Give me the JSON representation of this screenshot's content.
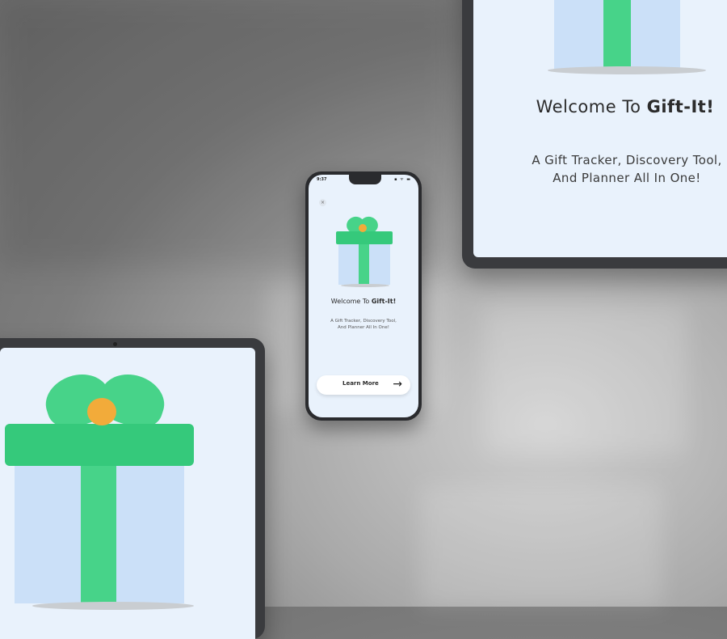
{
  "phone": {
    "status_time": "9:37",
    "status_icons": "▪︎ ᯤ ▬",
    "close_glyph": "×",
    "title_prefix": "Welcome To ",
    "title_brand": "Gift-It!",
    "subtitle_line1": "A Gift Tracker, Discovery Tool,",
    "subtitle_line2": "And Planner All In One!",
    "button_label": "Learn More",
    "button_arrow": "→"
  },
  "tablet_top_right": {
    "title_prefix": "Welcome To ",
    "title_brand": "Gift-It!",
    "subtitle_line1": "A Gift Tracker, Discovery Tool,",
    "subtitle_line2": "And Planner All In One!"
  },
  "colors": {
    "screen_bg": "#e9f2fc",
    "gift_green": "#47d389",
    "gift_box_blue": "#cbe0f8",
    "bow_knot_orange": "#f2ab3a",
    "device_frame": "#3a3b3e"
  },
  "icons": {
    "close": "close-icon",
    "arrow": "arrow-right-icon",
    "gift": "gift-icon"
  }
}
